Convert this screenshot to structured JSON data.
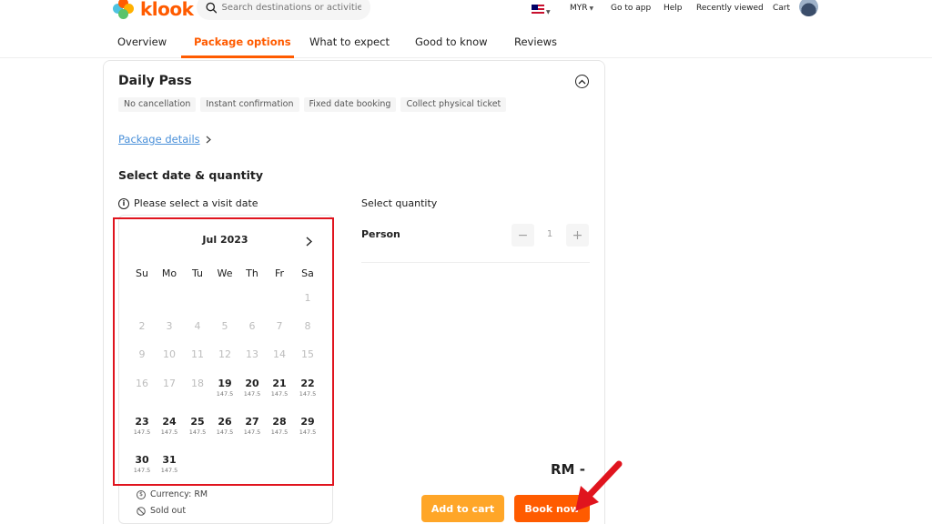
{
  "header": {
    "logo_text": "klook",
    "search_placeholder": "Search destinations or activities",
    "currency": "MYR",
    "go_to_app": "Go to app",
    "help": "Help",
    "recently_viewed": "Recently viewed",
    "cart": "Cart"
  },
  "tabs": [
    {
      "label": "Overview"
    },
    {
      "label": "Package options"
    },
    {
      "label": "What to expect"
    },
    {
      "label": "Good to know"
    },
    {
      "label": "Reviews"
    }
  ],
  "package": {
    "title": "Daily Pass",
    "tags": [
      "No cancellation",
      "Instant confirmation",
      "Fixed date booking",
      "Collect physical ticket"
    ],
    "details_link": "Package details",
    "section_title": "Select date & quantity",
    "visit_note": "Please select a visit date"
  },
  "calendar": {
    "month": "Jul 2023",
    "weekdays": [
      "Su",
      "Mo",
      "Tu",
      "We",
      "Th",
      "Fr",
      "Sa"
    ],
    "days": [
      {
        "n": "1",
        "price": ""
      },
      {
        "n": "2",
        "price": ""
      },
      {
        "n": "3",
        "price": ""
      },
      {
        "n": "4",
        "price": ""
      },
      {
        "n": "5",
        "price": ""
      },
      {
        "n": "6",
        "price": ""
      },
      {
        "n": "7",
        "price": ""
      },
      {
        "n": "8",
        "price": ""
      },
      {
        "n": "9",
        "price": ""
      },
      {
        "n": "10",
        "price": ""
      },
      {
        "n": "11",
        "price": ""
      },
      {
        "n": "12",
        "price": ""
      },
      {
        "n": "13",
        "price": ""
      },
      {
        "n": "14",
        "price": ""
      },
      {
        "n": "15",
        "price": ""
      },
      {
        "n": "16",
        "price": ""
      },
      {
        "n": "17",
        "price": ""
      },
      {
        "n": "18",
        "price": ""
      },
      {
        "n": "19",
        "price": "147.5"
      },
      {
        "n": "20",
        "price": "147.5"
      },
      {
        "n": "21",
        "price": "147.5"
      },
      {
        "n": "22",
        "price": "147.5"
      },
      {
        "n": "23",
        "price": "147.5"
      },
      {
        "n": "24",
        "price": "147.5"
      },
      {
        "n": "25",
        "price": "147.5"
      },
      {
        "n": "26",
        "price": "147.5"
      },
      {
        "n": "27",
        "price": "147.5"
      },
      {
        "n": "28",
        "price": "147.5"
      },
      {
        "n": "29",
        "price": "147.5"
      },
      {
        "n": "30",
        "price": "147.5"
      },
      {
        "n": "31",
        "price": "147.5"
      }
    ],
    "legend_currency": "Currency: RM",
    "legend_sold_out": "Sold out"
  },
  "quantity": {
    "title": "Select quantity",
    "label": "Person",
    "value": "1",
    "minus": "−",
    "plus": "+"
  },
  "footer": {
    "total": "RM -",
    "add_to_cart": "Add to cart",
    "book_now": "Book now"
  },
  "colors": {
    "brand": "#ff5b00",
    "secondary": "#ffa628",
    "annotation": "#e0141e"
  },
  "icons": {
    "search": "search-icon",
    "flag": "malaysia-flag-icon",
    "collapse": "chevron-up-circle-icon",
    "next_month": "chevron-right-icon",
    "info": "info-icon",
    "currency": "dollar-circle-icon",
    "sold_out": "no-entry-icon"
  }
}
